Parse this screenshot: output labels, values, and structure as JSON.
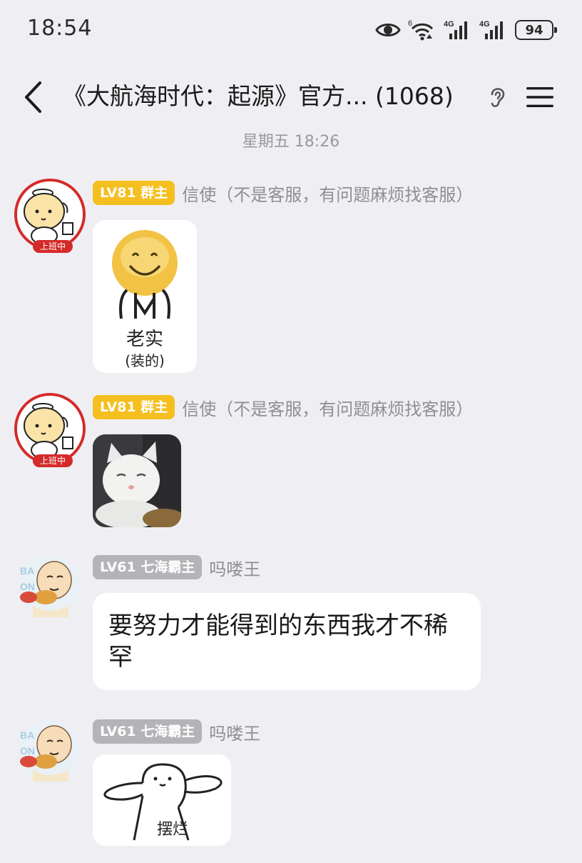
{
  "status_bar": {
    "time": "18:54",
    "signal_label_1": "6",
    "network_1": "4G",
    "network_2": "4G",
    "battery": "94"
  },
  "header": {
    "title": "《大航海时代：起源》官方... (1068)",
    "timestamp": "星期五 18:26"
  },
  "messages": [
    {
      "level": "LV81",
      "rank": "群主",
      "sender": "信使（不是客服，有问题麻烦找客服）",
      "avatar_status": "上班中",
      "sticker_text": [
        "老实",
        "(装的)"
      ]
    },
    {
      "level": "LV81",
      "rank": "群主",
      "sender": "信使（不是客服，有问题麻烦找客服）",
      "avatar_status": "上班中"
    },
    {
      "level": "LV61",
      "rank": "七海霸主",
      "sender": "吗喽王",
      "text": "要努力才能得到的东西我才不稀罕"
    },
    {
      "level": "LV61",
      "rank": "七海霸主",
      "sender": "吗喽王",
      "sticker_text": [
        "摆烂"
      ]
    }
  ],
  "colors": {
    "background": "#efeff3",
    "owner_badge": "#f4bf1f",
    "member_badge": "#b4b4b8",
    "avatar_ring": "#d52a2a"
  }
}
